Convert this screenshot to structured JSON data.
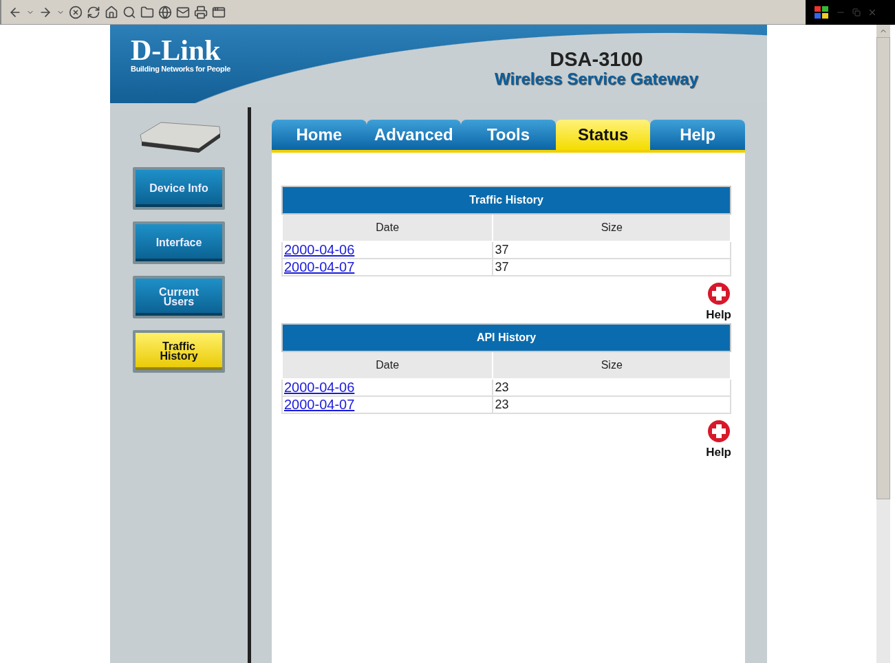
{
  "header": {
    "logo": "D-Link",
    "tagline": "Building Networks for People",
    "model": "DSA-3100",
    "product": "Wireless Service Gateway"
  },
  "tabs": [
    {
      "label": "Home",
      "selected": false
    },
    {
      "label": "Advanced",
      "selected": false
    },
    {
      "label": "Tools",
      "selected": false
    },
    {
      "label": "Status",
      "selected": true
    },
    {
      "label": "Help",
      "selected": false
    }
  ],
  "sidebar": {
    "items": [
      {
        "label": "Device Info",
        "selected": false
      },
      {
        "label": "Interface",
        "selected": false
      },
      {
        "label": "Current Users",
        "selected": false
      },
      {
        "label": "Traffic History",
        "selected": true
      }
    ]
  },
  "sections": [
    {
      "title": "Traffic History",
      "columns": [
        "Date",
        "Size"
      ],
      "rows": [
        [
          "2000-04-06",
          "37"
        ],
        [
          "2000-04-07",
          "37"
        ]
      ],
      "help": "Help"
    },
    {
      "title": "API History",
      "columns": [
        "Date",
        "Size"
      ],
      "rows": [
        [
          "2000-04-06",
          "23"
        ],
        [
          "2000-04-07",
          "23"
        ]
      ],
      "help": "Help"
    }
  ]
}
